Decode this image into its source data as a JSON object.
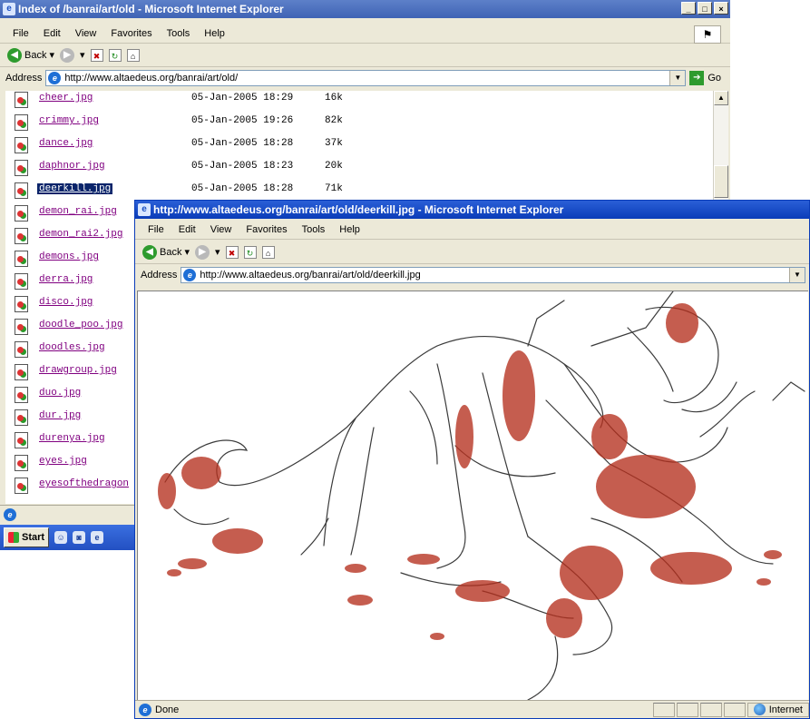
{
  "back_window": {
    "title": "Index of /banrai/art/old - Microsoft Internet Explorer",
    "menu": [
      "File",
      "Edit",
      "View",
      "Favorites",
      "Tools",
      "Help"
    ],
    "toolbar": {
      "back_label": "Back"
    },
    "address": {
      "label": "Address",
      "url": "http://www.altaedeus.org/banrai/art/old/",
      "go_label": "Go"
    },
    "files": [
      {
        "name": "cheer.jpg",
        "date": "05-Jan-2005 18:29",
        "size": "16k"
      },
      {
        "name": "crimmy.jpg",
        "date": "05-Jan-2005 19:26",
        "size": "82k"
      },
      {
        "name": "dance.jpg",
        "date": "05-Jan-2005 18:28",
        "size": "37k"
      },
      {
        "name": "daphnor.jpg",
        "date": "05-Jan-2005 18:23",
        "size": "20k"
      },
      {
        "name": "deerkill.jpg",
        "date": "05-Jan-2005 18:28",
        "size": "71k",
        "selected": true
      },
      {
        "name": "demon_rai.jpg",
        "date": "",
        "size": ""
      },
      {
        "name": "demon_rai2.jpg",
        "date": "",
        "size": ""
      },
      {
        "name": "demons.jpg",
        "date": "",
        "size": ""
      },
      {
        "name": "derra.jpg",
        "date": "",
        "size": ""
      },
      {
        "name": "disco.jpg",
        "date": "",
        "size": ""
      },
      {
        "name": "doodle_poo.jpg",
        "date": "",
        "size": ""
      },
      {
        "name": "doodles.jpg",
        "date": "",
        "size": ""
      },
      {
        "name": "drawgroup.jpg",
        "date": "",
        "size": ""
      },
      {
        "name": "duo.jpg",
        "date": "",
        "size": ""
      },
      {
        "name": "dur.jpg",
        "date": "",
        "size": ""
      },
      {
        "name": "durenya.jpg",
        "date": "",
        "size": ""
      },
      {
        "name": "eyes.jpg",
        "date": "",
        "size": ""
      },
      {
        "name": "eyesofthedragon",
        "date": "",
        "size": ""
      }
    ]
  },
  "taskbar": {
    "start_label": "Start"
  },
  "front_window": {
    "title": "http://www.altaedeus.org/banrai/art/old/deerkill.jpg - Microsoft Internet Explorer",
    "menu": [
      "File",
      "Edit",
      "View",
      "Favorites",
      "Tools",
      "Help"
    ],
    "toolbar": {
      "back_label": "Back"
    },
    "address": {
      "label": "Address",
      "url": "http://www.altaedeus.org/banrai/art/old/deerkill.jpg"
    },
    "status": {
      "text": "Done",
      "zone": "Internet"
    }
  },
  "colors": {
    "title_active": "#0a3cb8",
    "chrome": "#ece9d8",
    "link_visited": "#800080",
    "selection": "#0a246a",
    "blood": "#b5301e"
  }
}
